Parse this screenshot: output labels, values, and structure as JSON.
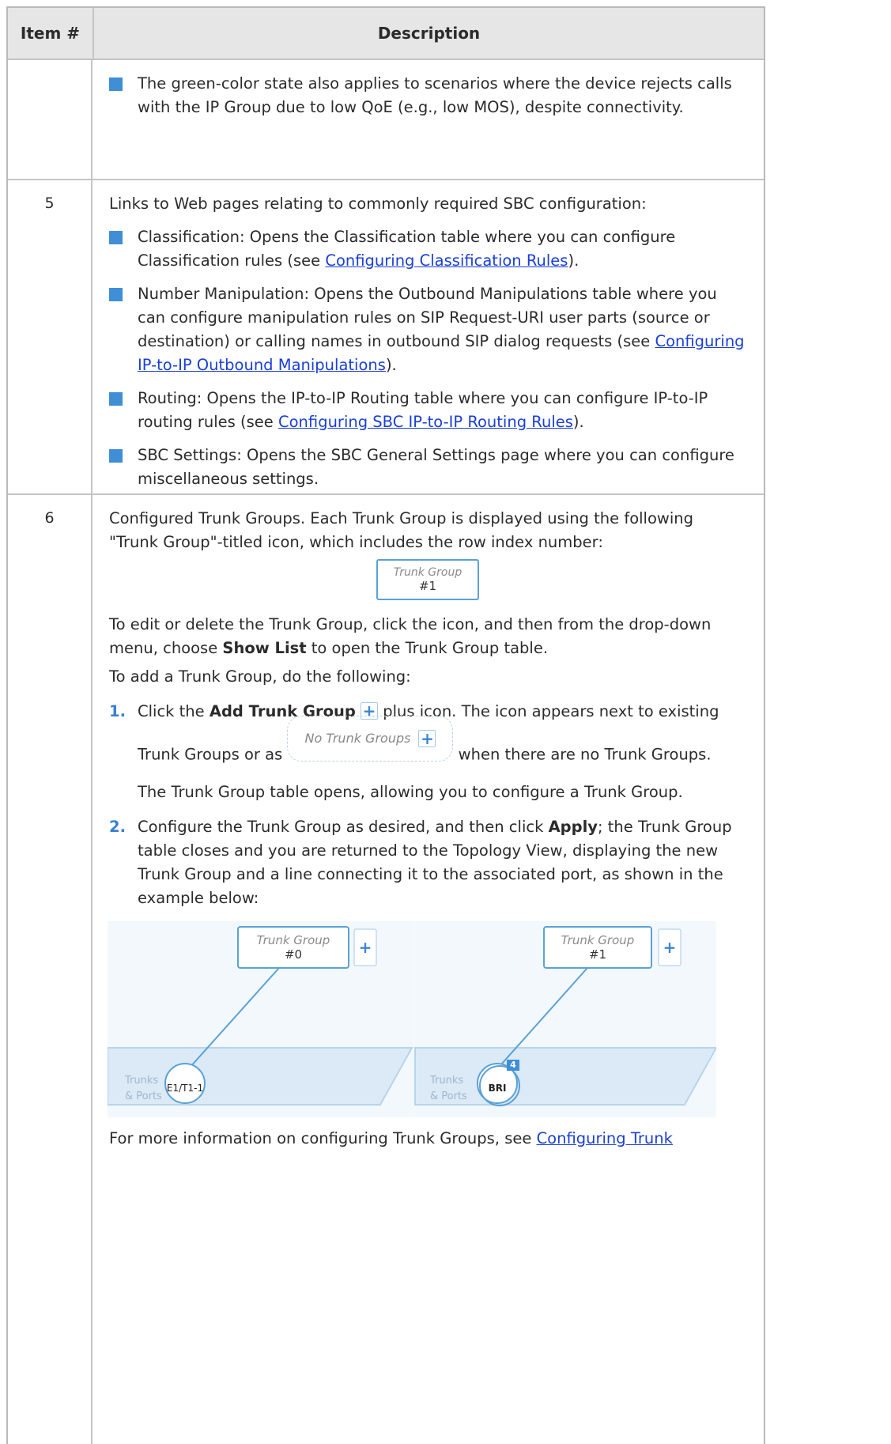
{
  "header": {
    "col1": "Item #",
    "col2": "Description"
  },
  "row0": {
    "bullet": "The green-color state also applies to scenarios where the device rejects calls with the IP Group due to low QoE (e.g., low MOS), despite connectivity."
  },
  "row5": {
    "item": "5",
    "intro": "Links to Web pages relating to commonly required SBC configuration:",
    "b1_pre": "Classification: Opens the Classification table where you can configure Classification rules (see ",
    "b1_link": "Configuring Classification Rules",
    "b1_post": ").",
    "b2_pre": "Number Manipulation: Opens the Outbound Manipulations table where you can configure manipulation rules on SIP Request-URI user parts (source or destination) or calling names in outbound SIP dialog requests (see ",
    "b2_link": "Configuring IP-to-IP Outbound Manipulations",
    "b2_post": ").",
    "b3_pre": "Routing: Opens the IP-to-IP Routing table where you can configure IP-to-IP routing rules (see ",
    "b3_link": "Configuring SBC IP-to-IP Routing Rules",
    "b3_post": ").",
    "b4": "SBC Settings: Opens the SBC General Settings page where you can configure miscellaneous settings."
  },
  "row6": {
    "item": "6",
    "intro": "Configured Trunk Groups. Each Trunk Group is displayed using the following \"Trunk Group\"-titled icon, which includes the row index number:",
    "icon_title": "Trunk Group",
    "icon_num": "#1",
    "edit_pre": "To edit or delete the Trunk Group, click the icon, and then from the drop-down menu, choose ",
    "edit_bold": "Show List",
    "edit_post": " to open the Trunk Group table.",
    "add_intro": "To add a Trunk Group, do the following:",
    "step1_num": "1.",
    "step1_pre": "Click the ",
    "step1_bold": "Add Trunk Group",
    "step1_mid": " plus icon. The icon appears next to existing",
    "step1_line2_pre": "Trunk Groups or as",
    "no_groups_label": "No Trunk Groups",
    "step1_line2_post": "when there are no Trunk Groups.",
    "step1_para": "The Trunk Group table opens, allowing you to configure a Trunk Group.",
    "step2_num": "2.",
    "step2_pre": "Configure the Trunk Group as desired, and then click ",
    "step2_bold": "Apply",
    "step2_post": "; the Trunk Group table closes and you are returned to the Topology View, displaying the new Trunk Group and a line connecting it to the associated port, as shown in the example below:",
    "diagram": {
      "left": {
        "title": "Trunk Group",
        "num": "#0",
        "port": "E1/T1-1",
        "area1": "Trunks",
        "area2": "& Ports"
      },
      "right": {
        "title": "Trunk Group",
        "num": "#1",
        "port": "BRI",
        "badge": "4",
        "area1": "Trunks",
        "area2": "& Ports"
      }
    },
    "more_pre": "For more information on configuring Trunk Groups, see ",
    "more_link": "Configuring Trunk"
  },
  "colors": {
    "accent": "#3f8ed6",
    "link": "#1a3fd6",
    "header_bg": "#e6e6e6"
  }
}
